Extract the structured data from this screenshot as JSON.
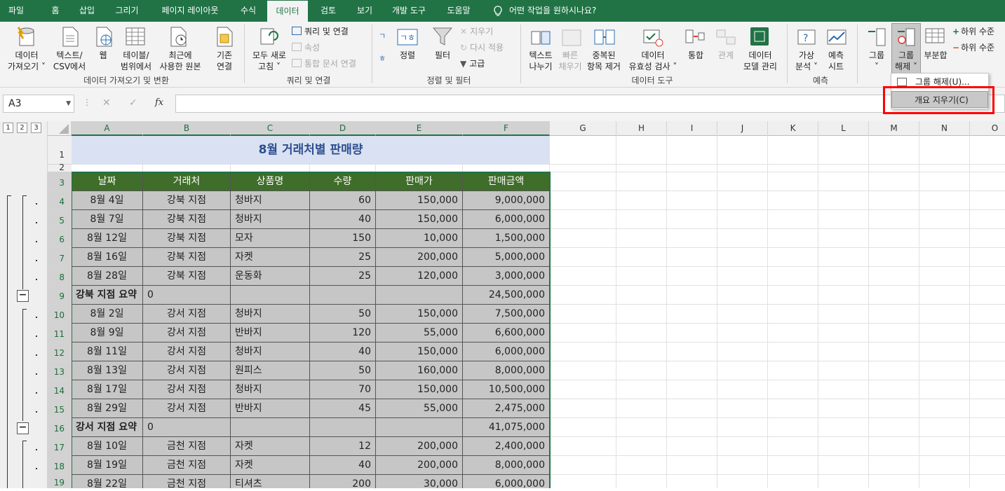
{
  "tabs": [
    {
      "label": "파일"
    },
    {
      "label": "홈"
    },
    {
      "label": "삽입"
    },
    {
      "label": "그리기"
    },
    {
      "label": "페이지 레이아웃"
    },
    {
      "label": "수식"
    },
    {
      "label": "데이터"
    },
    {
      "label": "검토"
    },
    {
      "label": "보기"
    },
    {
      "label": "개발 도구"
    },
    {
      "label": "도움말"
    }
  ],
  "tell_me": "어떤 작업을 원하시나요?",
  "ribbon": {
    "get_data": [
      "데이터",
      "가져오기 ˅"
    ],
    "text_csv": [
      "텍스트/",
      "CSV에서"
    ],
    "web": "웹",
    "table_range": [
      "테이블/",
      "범위에서"
    ],
    "recent": [
      "최근에",
      "사용한 원본"
    ],
    "existing": [
      "기존",
      "연결"
    ],
    "group1_label": "데이터 가져오기 및 변환",
    "refresh_all": [
      "모두 새로",
      "고침 ˅"
    ],
    "queries_conn": "쿼리 및 연결",
    "properties": "속성",
    "edit_links": "통합 문서 연결",
    "group2_label": "쿼리 및 연결",
    "sort": "정렬",
    "filter": "필터",
    "clear": "지우기",
    "reapply": "다시 적용",
    "advanced": "고급",
    "group3_label": "정렬 및 필터",
    "text_to_col": [
      "텍스트",
      "나누기"
    ],
    "flash_fill": [
      "빠른",
      "채우기"
    ],
    "remove_dup": [
      "중복된",
      "항목 제거"
    ],
    "validation": [
      "데이터",
      "유효성 검사 ˅"
    ],
    "consolidate": "통합",
    "relations": "관계",
    "data_model": [
      "데이터",
      "모델 관리"
    ],
    "group4_label": "데이터 도구",
    "whatif": [
      "가상",
      "분석 ˅"
    ],
    "forecast": [
      "예측",
      "시트"
    ],
    "group5_label": "예측",
    "group": [
      "그룹",
      "˅"
    ],
    "ungroup": [
      "그룹",
      "해제 ˅"
    ],
    "subtotal": "부분합",
    "show_detail": "하위 수준",
    "hide_detail": "하위 수준"
  },
  "dropdown": {
    "ungroup": "그룹 해제(U)...",
    "clear_outline": "개요 지우기(C)"
  },
  "formula_bar": {
    "name_box": "A3",
    "fx": "fx",
    "cancel": "✕",
    "enter": "✓",
    "value": ""
  },
  "outline_levels": [
    "1",
    "2",
    "3"
  ],
  "columns": [
    "A",
    "B",
    "C",
    "D",
    "E",
    "F",
    "G",
    "H",
    "I",
    "J",
    "K",
    "L",
    "M",
    "N",
    "O"
  ],
  "rows": [
    "1",
    "2",
    "3",
    "4",
    "5",
    "6",
    "7",
    "8",
    "9",
    "10",
    "11",
    "12",
    "13",
    "14",
    "15",
    "16",
    "17",
    "18",
    "19"
  ],
  "sheet": {
    "title": "8월 거래처별 판매량",
    "headers": [
      "날짜",
      "거래처",
      "상품명",
      "수량",
      "판매가",
      "판매금액"
    ],
    "data": [
      [
        "8월 4일",
        "강북 지점",
        "청바지",
        "60",
        "150,000",
        "9,000,000"
      ],
      [
        "8월 7일",
        "강북 지점",
        "청바지",
        "40",
        "150,000",
        "6,000,000"
      ],
      [
        "8월 12일",
        "강북 지점",
        "모자",
        "150",
        "10,000",
        "1,500,000"
      ],
      [
        "8월 16일",
        "강북 지점",
        "자켓",
        "25",
        "200,000",
        "5,000,000"
      ],
      [
        "8월 28일",
        "강북 지점",
        "운동화",
        "25",
        "120,000",
        "3,000,000"
      ],
      [
        "강북 지점 요약",
        "0",
        "",
        "",
        "",
        "24,500,000"
      ],
      [
        "8월 2일",
        "강서 지점",
        "청바지",
        "50",
        "150,000",
        "7,500,000"
      ],
      [
        "8월 9일",
        "강서 지점",
        "반바지",
        "120",
        "55,000",
        "6,600,000"
      ],
      [
        "8월 11일",
        "강서 지점",
        "청바지",
        "40",
        "150,000",
        "6,000,000"
      ],
      [
        "8월 13일",
        "강서 지점",
        "원피스",
        "50",
        "160,000",
        "8,000,000"
      ],
      [
        "8월 17일",
        "강서 지점",
        "청바지",
        "70",
        "150,000",
        "10,500,000"
      ],
      [
        "8월 29일",
        "강서 지점",
        "반바지",
        "45",
        "55,000",
        "2,475,000"
      ],
      [
        "강서 지점 요약",
        "0",
        "",
        "",
        "",
        "41,075,000"
      ],
      [
        "8월 10일",
        "금천 지점",
        "자켓",
        "12",
        "200,000",
        "2,400,000"
      ],
      [
        "8월 19일",
        "금천 지점",
        "자켓",
        "40",
        "200,000",
        "8,000,000"
      ],
      [
        "8월 22일",
        "금천 지점",
        "티셔츠",
        "200",
        "30,000",
        "6,000,000"
      ]
    ]
  },
  "colors": {
    "tab_bar": "#217346",
    "header_fill": "#3f6d2a",
    "title_fill": "#d9e1f2",
    "data_fill": "#c6c6c6",
    "highlight": "#ff0000"
  }
}
